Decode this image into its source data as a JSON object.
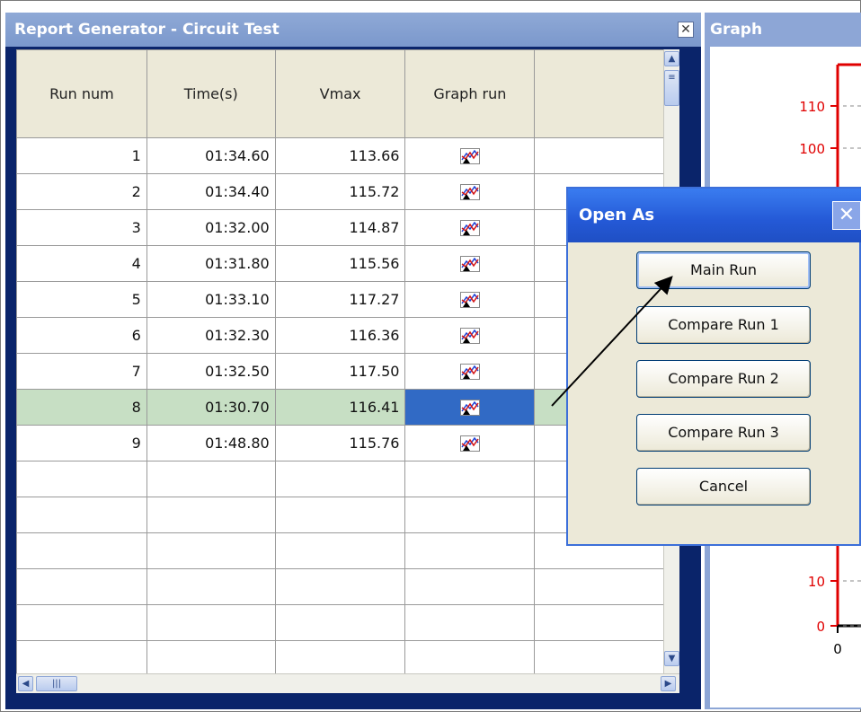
{
  "left_window": {
    "title": "Report Generator - Circuit Test",
    "close_glyph": "✕"
  },
  "table": {
    "columns": [
      "Run num",
      "Time(s)",
      "Vmax",
      "Graph run",
      ""
    ],
    "rows": [
      {
        "run": "1",
        "time": "01:34.60",
        "vmax": "113.66"
      },
      {
        "run": "2",
        "time": "01:34.40",
        "vmax": "115.72"
      },
      {
        "run": "3",
        "time": "01:32.00",
        "vmax": "114.87"
      },
      {
        "run": "4",
        "time": "01:31.80",
        "vmax": "115.56"
      },
      {
        "run": "5",
        "time": "01:33.10",
        "vmax": "117.27"
      },
      {
        "run": "6",
        "time": "01:32.30",
        "vmax": "116.36"
      },
      {
        "run": "7",
        "time": "01:32.50",
        "vmax": "117.50"
      },
      {
        "run": "8",
        "time": "01:30.70",
        "vmax": "116.41"
      },
      {
        "run": "9",
        "time": "01:48.80",
        "vmax": "115.76"
      }
    ],
    "selected_run": "8",
    "empty_rows": 6
  },
  "graph_window": {
    "title": "Graph",
    "y_ticks": [
      "110",
      "100",
      "10",
      "0"
    ],
    "x_ticks": [
      "0"
    ]
  },
  "dialog": {
    "title": "Open As",
    "close_glyph": "✕",
    "buttons": {
      "main_run": "Main Run",
      "compare_1": "Compare Run 1",
      "compare_2": "Compare Run 2",
      "compare_3": "Compare Run 3",
      "cancel": "Cancel"
    }
  },
  "colors": {
    "selected_row": "#c7dfc4",
    "selected_cell": "#316ac5",
    "dialog_title": "#2459d6",
    "axis_red": "#e00000"
  }
}
